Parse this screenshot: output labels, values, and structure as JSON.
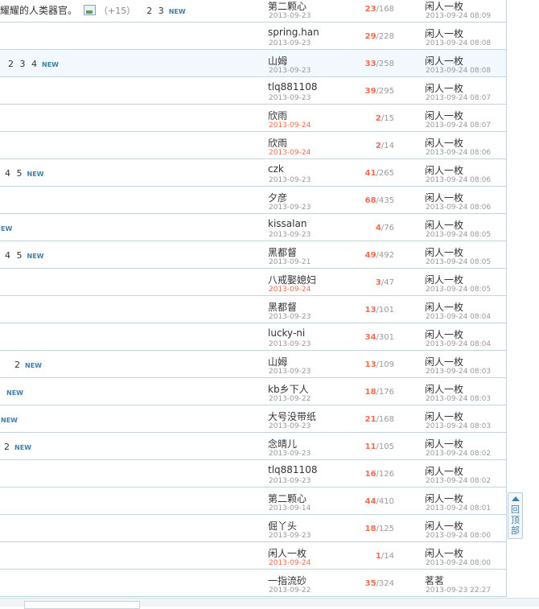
{
  "threads": [
    {
      "title": "耀耀的人类器官。",
      "image": true,
      "plus": "（+15）",
      "pages": "2 3",
      "new": "NEW",
      "author": "第二颗心",
      "author_date": "2013-09-23",
      "author_new": false,
      "replies": "23",
      "views": "168",
      "last_poster": "闲人一枚",
      "last_date": "2013-09-24 08:09",
      "highlight": false
    },
    {
      "title": "",
      "image": false,
      "plus": "",
      "pages": "",
      "new": "",
      "author": "spring.han",
      "author_date": "2013-09-23",
      "author_new": false,
      "replies": "29",
      "views": "228",
      "last_poster": "闲人一枚",
      "last_date": "2013-09-24 08:08",
      "highlight": false
    },
    {
      "title": "",
      "image": false,
      "plus": "",
      "pages": "2 3 4",
      "new": "NEW",
      "author": "山姆",
      "author_date": "2013-09-23",
      "author_new": false,
      "replies": "33",
      "views": "258",
      "last_poster": "闲人一枚",
      "last_date": "2013-09-24 08:08",
      "highlight": true
    },
    {
      "title": "",
      "image": false,
      "plus": "",
      "pages": "",
      "new": "",
      "author": "tlq881108",
      "author_date": "2013-09-23",
      "author_new": false,
      "replies": "39",
      "views": "295",
      "last_poster": "闲人一枚",
      "last_date": "2013-09-24 08:07",
      "highlight": false
    },
    {
      "title": "",
      "image": false,
      "plus": "",
      "pages": "",
      "new": "",
      "author": "欣雨",
      "author_date": "2013-09-24",
      "author_new": true,
      "replies": "2",
      "views": "15",
      "last_poster": "闲人一枚",
      "last_date": "2013-09-24 08:07",
      "highlight": false
    },
    {
      "title": "",
      "image": false,
      "plus": "",
      "pages": "",
      "new": "",
      "author": "欣雨",
      "author_date": "2013-09-24",
      "author_new": true,
      "replies": "2",
      "views": "14",
      "last_poster": "闲人一枚",
      "last_date": "2013-09-24 08:06",
      "highlight": false
    },
    {
      "title": "",
      "image": false,
      "plus": "",
      "pages": "4 5",
      "new": "NEW",
      "author": "czk",
      "author_date": "2013-09-23",
      "author_new": false,
      "replies": "41",
      "views": "265",
      "last_poster": "闲人一枚",
      "last_date": "2013-09-24 08:06",
      "highlight": false
    },
    {
      "title": "",
      "image": false,
      "plus": "",
      "pages": "",
      "new": "",
      "author": "夕彦",
      "author_date": "2013-09-23",
      "author_new": false,
      "replies": "68",
      "views": "435",
      "last_poster": "闲人一枚",
      "last_date": "2013-09-24 08:06",
      "highlight": false
    },
    {
      "title": "",
      "image": false,
      "plus": "",
      "pages": "",
      "new": "EW",
      "author": "kissalan",
      "author_date": "2013-09-23",
      "author_new": false,
      "replies": "4",
      "views": "76",
      "last_poster": "闲人一枚",
      "last_date": "2013-09-24 08:05",
      "highlight": false
    },
    {
      "title": "",
      "image": false,
      "plus": "",
      "pages": "4 5",
      "new": "NEW",
      "author": "黑都督",
      "author_date": "2013-09-21",
      "author_new": false,
      "replies": "49",
      "views": "492",
      "last_poster": "闲人一枚",
      "last_date": "2013-09-24 08:05",
      "highlight": false
    },
    {
      "title": "",
      "image": false,
      "plus": "",
      "pages": "",
      "new": "",
      "author": "八戒娶媳妇",
      "author_date": "2013-09-24",
      "author_new": true,
      "replies": "3",
      "views": "47",
      "last_poster": "闲人一枚",
      "last_date": "2013-09-24 08:05",
      "highlight": false
    },
    {
      "title": "",
      "image": false,
      "plus": "",
      "pages": "",
      "new": "",
      "author": "黑都督",
      "author_date": "2013-09-23",
      "author_new": false,
      "replies": "13",
      "views": "101",
      "last_poster": "闲人一枚",
      "last_date": "2013-09-24 08:04",
      "highlight": false
    },
    {
      "title": "",
      "image": false,
      "plus": "",
      "pages": "",
      "new": "",
      "author": "lucky-ni",
      "author_date": "2013-09-23",
      "author_new": false,
      "replies": "34",
      "views": "301",
      "last_poster": "闲人一枚",
      "last_date": "2013-09-24 08:04",
      "highlight": false
    },
    {
      "title": "",
      "image": false,
      "plus": "",
      "pages": "2",
      "new": "NEW",
      "author": "山姆",
      "author_date": "2013-09-23",
      "author_new": false,
      "replies": "13",
      "views": "109",
      "last_poster": "闲人一枚",
      "last_date": "2013-09-24 08:03",
      "highlight": false
    },
    {
      "title": "",
      "image": false,
      "plus": "",
      "pages": "",
      "new": "NEW",
      "author": "kb乡下人",
      "author_date": "2013-09-22",
      "author_new": false,
      "replies": "18",
      "views": "176",
      "last_poster": "闲人一枚",
      "last_date": "2013-09-24 08:03",
      "highlight": false
    },
    {
      "title": "",
      "image": false,
      "plus": "",
      "pages": "",
      "new": "NEW",
      "author": "大号没带纸",
      "author_date": "2013-09-23",
      "author_new": false,
      "replies": "21",
      "views": "168",
      "last_poster": "闲人一枚",
      "last_date": "2013-09-24 08:03",
      "highlight": false
    },
    {
      "title": "",
      "image": false,
      "plus": "",
      "pages": "2",
      "new": "NEW",
      "author": "念晴儿",
      "author_date": "2013-09-23",
      "author_new": false,
      "replies": "11",
      "views": "105",
      "last_poster": "闲人一枚",
      "last_date": "2013-09-24 08:02",
      "highlight": false
    },
    {
      "title": "",
      "image": false,
      "plus": "",
      "pages": "",
      "new": "",
      "author": "tlq881108",
      "author_date": "2013-09-23",
      "author_new": false,
      "replies": "16",
      "views": "126",
      "last_poster": "闲人一枚",
      "last_date": "2013-09-24 08:02",
      "highlight": false
    },
    {
      "title": "",
      "image": false,
      "plus": "",
      "pages": "",
      "new": "",
      "author": "第二颗心",
      "author_date": "2013-09-14",
      "author_new": false,
      "replies": "44",
      "views": "410",
      "last_poster": "闲人一枚",
      "last_date": "2013-09-24 08:01",
      "highlight": false
    },
    {
      "title": "",
      "image": false,
      "plus": "",
      "pages": "",
      "new": "",
      "author": "倔丫头",
      "author_date": "2013-09-23",
      "author_new": false,
      "replies": "18",
      "views": "125",
      "last_poster": "闲人一枚",
      "last_date": "2013-09-24 08:00",
      "highlight": false
    },
    {
      "title": "",
      "image": false,
      "plus": "",
      "pages": "",
      "new": "",
      "author": "闲人一枚",
      "author_date": "2013-09-24",
      "author_new": true,
      "replies": "1",
      "views": "14",
      "last_poster": "闲人一枚",
      "last_date": "2013-09-24 08:00",
      "highlight": false
    },
    {
      "title": "",
      "image": false,
      "plus": "",
      "pages": "",
      "new": "",
      "author": "一指流砂",
      "author_date": "2013-09-22",
      "author_new": false,
      "replies": "35",
      "views": "324",
      "last_poster": "茗茗",
      "last_date": "2013-09-23 22:27",
      "highlight": false
    }
  ],
  "back_to_top": "回顶部"
}
